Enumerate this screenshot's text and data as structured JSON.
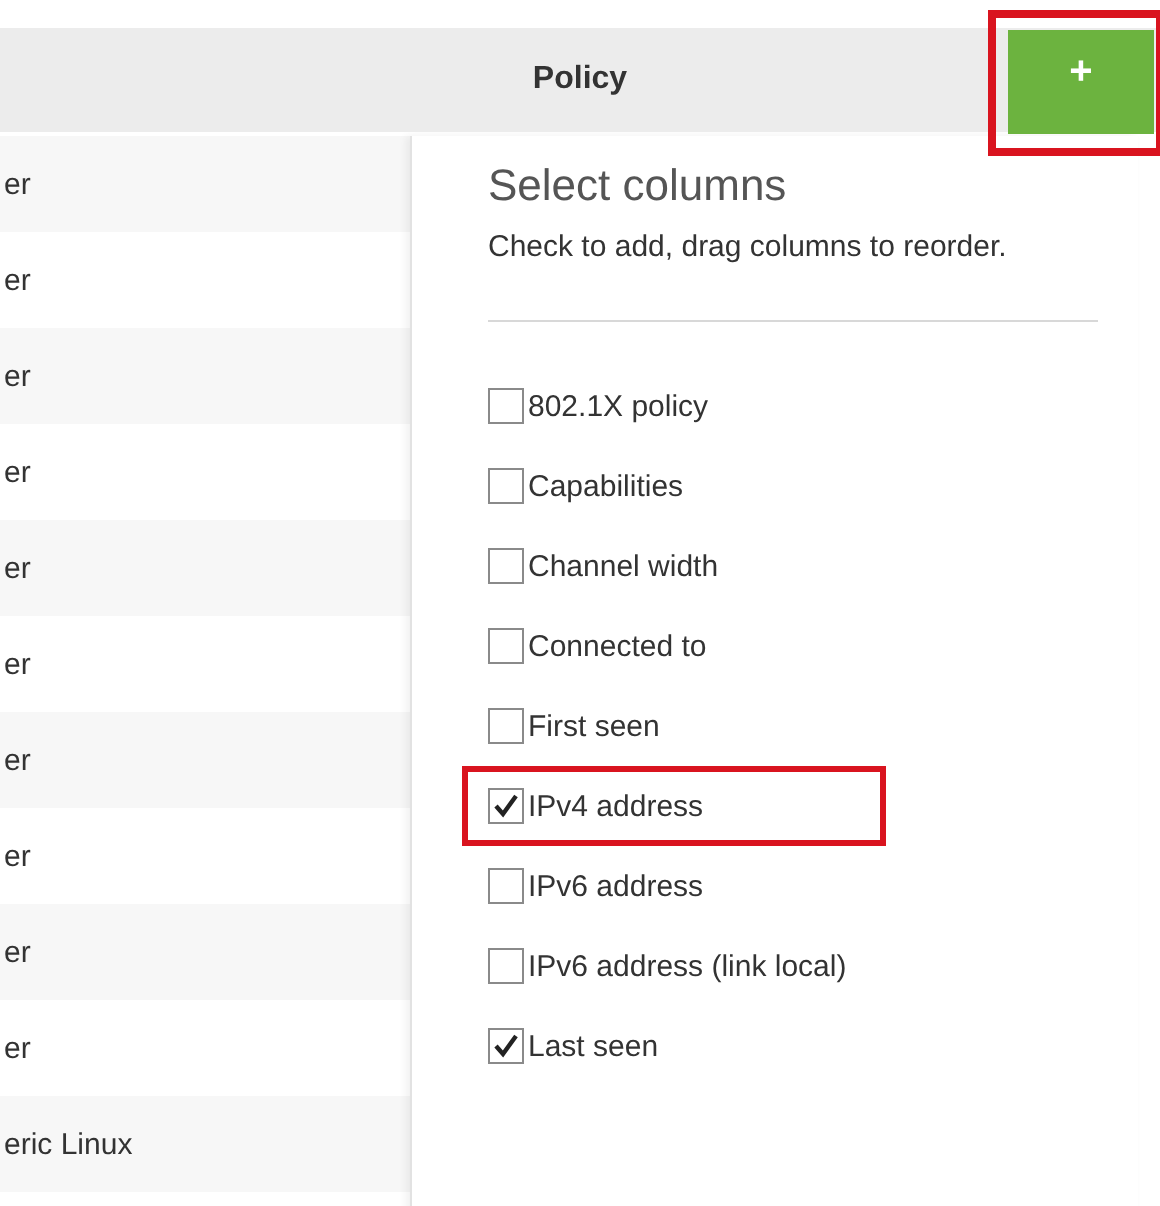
{
  "header": {
    "column_label": "Policy",
    "add_button": {
      "label": "+",
      "highlighted": true
    }
  },
  "table": {
    "rows": [
      {
        "cell": "er"
      },
      {
        "cell": "er"
      },
      {
        "cell": "er"
      },
      {
        "cell": "er"
      },
      {
        "cell": "er"
      },
      {
        "cell": "er"
      },
      {
        "cell": "er"
      },
      {
        "cell": "er"
      },
      {
        "cell": "er"
      },
      {
        "cell": "er"
      },
      {
        "cell": "eric Linux"
      }
    ]
  },
  "column_picker": {
    "title": "Select columns",
    "hint": "Check to add, drag columns to reorder.",
    "items": [
      {
        "label": "802.1X policy",
        "checked": false,
        "highlighted": false
      },
      {
        "label": "Capabilities",
        "checked": false,
        "highlighted": false
      },
      {
        "label": "Channel width",
        "checked": false,
        "highlighted": false
      },
      {
        "label": "Connected to",
        "checked": false,
        "highlighted": false
      },
      {
        "label": "First seen",
        "checked": false,
        "highlighted": false
      },
      {
        "label": "IPv4 address",
        "checked": true,
        "highlighted": true
      },
      {
        "label": "IPv6 address",
        "checked": false,
        "highlighted": false
      },
      {
        "label": "IPv6 address (link local)",
        "checked": false,
        "highlighted": false
      },
      {
        "label": "Last seen",
        "checked": true,
        "highlighted": false
      }
    ]
  }
}
